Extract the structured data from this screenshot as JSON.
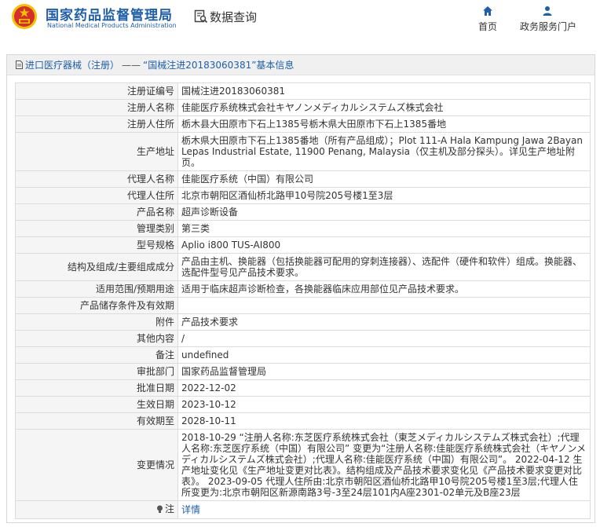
{
  "header": {
    "org_name_cn": "国家药品监督管理局",
    "org_name_en": "National Medical Products Administration",
    "query_label": "数据查询",
    "nav": {
      "home": "首页",
      "service": "政务服务门户"
    }
  },
  "breadcrumb": {
    "category": "进口医疗器械（注册）",
    "separator": "——",
    "current": "“国械注进20183060381”基本信息"
  },
  "rows": [
    {
      "label": "注册证编号",
      "value": "国械注进20183060381"
    },
    {
      "label": "注册人名称",
      "value": "佳能医疗系统株式会社キヤノンメディカルシステムズ株式会社"
    },
    {
      "label": "注册人住所",
      "value": "栃木县大田原市下石上1385号栃木県大田原市下石上1385番地"
    },
    {
      "label": "生产地址",
      "value": "栃木県大田原市下石上1385番地（所有产品组成）；Plot 111-A Hala Kampung Jawa 2Bayan Lepas Industrial Estate, 11900 Penang, Malaysia（仅主机及部分探头）。详见生产地址附页。"
    },
    {
      "label": "代理人名称",
      "value": "佳能医疗系统（中国）有限公司"
    },
    {
      "label": "代理人住所",
      "value": "北京市朝阳区酒仙桥北路甲10号院205号楼1至3层"
    },
    {
      "label": "产品名称",
      "value": "超声诊断设备"
    },
    {
      "label": "管理类别",
      "value": "第三类"
    },
    {
      "label": "型号规格",
      "value": "Aplio i800 TUS-AI800"
    },
    {
      "label": "结构及组成/主要组成成分",
      "value": "产品由主机、换能器（包括换能器可配用的穿刺连接器）、选配件（硬件和软件）组成。换能器、选配件型号见产品技术要求。"
    },
    {
      "label": "适用范围/预期用途",
      "value": "适用于临床超声诊断检查，各换能器临床应用部位见产品技术要求。"
    },
    {
      "label": "产品储存条件及有效期",
      "value": ""
    },
    {
      "label": "附件",
      "value": "产品技术要求"
    },
    {
      "label": "其他内容",
      "value": "/"
    },
    {
      "label": "备注",
      "value": "undefined"
    },
    {
      "label": "审批部门",
      "value": "国家药品监督管理局"
    },
    {
      "label": "批准日期",
      "value": "2022-12-02"
    },
    {
      "label": "生效日期",
      "value": "2023-10-12"
    },
    {
      "label": "有效期至",
      "value": "2028-10-11"
    },
    {
      "label": "变更情况",
      "value": "2018-10-29 “注册人名称:东芝医疗系统株式会社（東芝メディカルシステムズ株式会社）;代理人名称:东芝医疗系统（中国）有限公司” 变更为“注册人名称:佳能医疗系统株式会社（キヤノンメディカルシステムズ株式会社）;代理人名称:佳能医疗系统（中国）有限公司”。 2022-04-12 生产地址变化见《生产地址变更对比表》。结构组成及产品技术要求变化见《产品技术要求变更对比表》。 2023-09-05 代理人住所由:北京市朝阳区酒仙桥北路甲10号院205号楼1至3层;代理人住所变更为:北京市朝阳区新源南路3号-3至24层101内A座2301-02单元及B座23层"
    }
  ],
  "note": {
    "label": "注",
    "link": "详情"
  },
  "icons": {
    "emblem": "national-emblem-icon",
    "query": "search-document-icon",
    "home": "home-icon",
    "service": "user-icon",
    "breadcrumb": "document-icon",
    "note": "lightbulb-icon"
  },
  "colors": {
    "brand": "#1f5fa8",
    "emblem_red": "#d32f2f",
    "emblem_gold": "#f2c200",
    "label_bg": "#f5f5f5",
    "title_bg": "#f0f0f0"
  }
}
